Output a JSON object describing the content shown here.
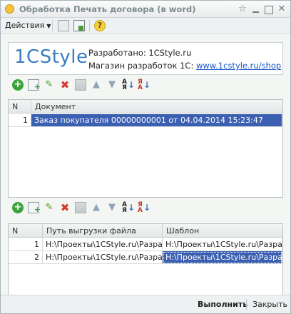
{
  "window": {
    "title": "Обработка  Печать договора (в word)",
    "icons": [
      "app-icon",
      "star-icon",
      "minimize-icon",
      "maximize-icon",
      "close-icon"
    ]
  },
  "commandbar": {
    "actions_label": "Действия",
    "icons": [
      "document-icon",
      "document-export-icon",
      "help-icon"
    ],
    "help_glyph": "?"
  },
  "banner": {
    "logo": "1CStyle",
    "developed_label": "Разработано:",
    "developed_value": "1CStyle.ru",
    "shop_label": "Магазин разработок 1С:",
    "shop_link": "www.1cstyle.ru/shop"
  },
  "toolbar_icons": [
    "add-icon",
    "copy-icon",
    "edit-icon",
    "delete-icon",
    "grid-icon",
    "move-up-icon",
    "move-down-icon",
    "sort-asc-icon",
    "sort-desc-icon"
  ],
  "documents_table": {
    "columns": [
      "N",
      "Документ"
    ],
    "rows": [
      {
        "n": "1",
        "document": "Заказ покупателя 00000000001 от 04.04.2014 15:23:47"
      }
    ]
  },
  "templates_table": {
    "columns": [
      "N",
      "Путь выгрузки файла",
      "Шаблон"
    ],
    "rows": [
      {
        "n": "1",
        "path": "H:\\Проекты\\1CStyle.ru\\Разра...",
        "template": "H:\\Проекты\\1CStyle.ru\\Разра..."
      },
      {
        "n": "2",
        "path": "H:\\Проекты\\1CStyle.ru\\Разра...",
        "template": "H:\\Проекты\\1CStyle.ru\\Разра..."
      }
    ]
  },
  "footer": {
    "run_label": "Выполнить",
    "close_label": "Закрыть"
  }
}
